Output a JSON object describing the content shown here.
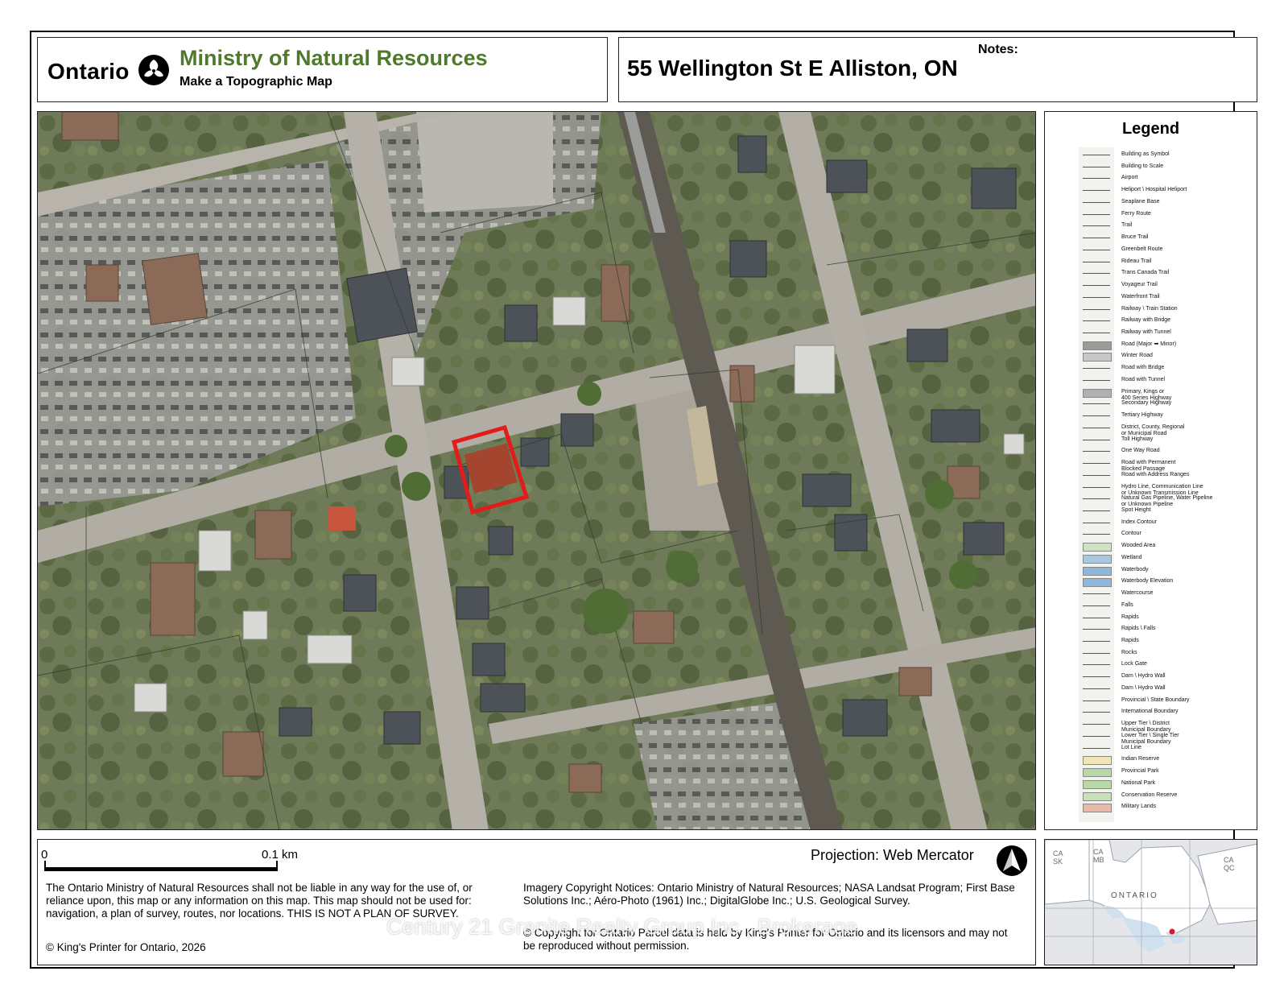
{
  "header": {
    "ontario_wordmark": "Ontario",
    "ministry": "Ministry of Natural Resources",
    "subtitle": "Make a Topographic Map",
    "address": "55 Wellington St E Alliston, ON",
    "notes_label": "Notes:"
  },
  "legend": {
    "title": "Legend",
    "items": [
      {
        "label": "Building as Symbol",
        "symbol": "dot-icon"
      },
      {
        "label": "Building to Scale",
        "symbol": "building-icon"
      },
      {
        "label": "Airport",
        "symbol": "airport-icon"
      },
      {
        "label": "Heliport \\ Hospital Heliport",
        "symbol": "heliport-icon"
      },
      {
        "label": "Seaplane Base",
        "symbol": "seaplane-icon"
      },
      {
        "label": "Ferry Route",
        "symbol": "ferry-icon"
      },
      {
        "label": "Trail",
        "symbol": "trail-icon"
      },
      {
        "label": "Bruce Trail",
        "symbol": "bruce-trail-icon"
      },
      {
        "label": "Greenbelt Route",
        "symbol": "greenbelt-icon"
      },
      {
        "label": "Rideau Trail",
        "symbol": "rideau-icon"
      },
      {
        "label": "Trans Canada Trail",
        "symbol": "trans-canada-icon"
      },
      {
        "label": "Voyageur Trail",
        "symbol": "voyageur-icon"
      },
      {
        "label": "Waterfront Trail",
        "symbol": "waterfront-icon"
      },
      {
        "label": "Railway \\ Train Station",
        "symbol": "railway-icon"
      },
      {
        "label": "Railway with Bridge",
        "symbol": "railway-bridge-icon"
      },
      {
        "label": "Railway with Tunnel",
        "symbol": "railway-tunnel-icon"
      },
      {
        "label": "Road (Major ➡ Minor)",
        "symbol": "road-icon"
      },
      {
        "label": "Winter Road",
        "symbol": "winter-road-icon"
      },
      {
        "label": "Road with Bridge",
        "symbol": "road-bridge-icon"
      },
      {
        "label": "Road with Tunnel",
        "symbol": "road-tunnel-icon"
      },
      {
        "label": "Primary, Kings or\n400 Series Highway",
        "symbol": "highway-icon"
      },
      {
        "label": "Secondary Highway",
        "symbol": "secondary-highway-icon"
      },
      {
        "label": "Tertiary Highway",
        "symbol": "tertiary-highway-icon"
      },
      {
        "label": "District, County, Regional\nor Municipal Road",
        "symbol": "county-road-icon"
      },
      {
        "label": "Toll Highway",
        "symbol": "toll-highway-icon"
      },
      {
        "label": "One Way Road",
        "symbol": "one-way-icon"
      },
      {
        "label": "Road with Permanent\nBlocked Passage",
        "symbol": "blocked-road-icon"
      },
      {
        "label": "Road with Address Ranges",
        "symbol": "address-range-icon"
      },
      {
        "label": "Hydro Line, Communication Line\nor Unknown Transmission Line",
        "symbol": "hydro-line-icon"
      },
      {
        "label": "Natural Gas Pipeline, Water Pipeline\nor Unknown Pipeline",
        "symbol": "pipeline-icon"
      },
      {
        "label": "Spot Height",
        "symbol": "spot-height-icon"
      },
      {
        "label": "Index Contour",
        "symbol": "index-contour-icon"
      },
      {
        "label": "Contour",
        "symbol": "contour-icon"
      },
      {
        "label": "Wooded Area",
        "symbol": "wooded-area-icon"
      },
      {
        "label": "Wetland",
        "symbol": "wetland-icon"
      },
      {
        "label": "Waterbody",
        "symbol": "waterbody-icon"
      },
      {
        "label": "Waterbody Elevation",
        "symbol": "waterbody-elevation-icon"
      },
      {
        "label": "Watercourse",
        "symbol": "watercourse-icon"
      },
      {
        "label": "Falls",
        "symbol": "falls-icon"
      },
      {
        "label": "Rapids",
        "symbol": "rapids-icon"
      },
      {
        "label": "Rapids \\ Falls",
        "symbol": "rapids-falls-icon"
      },
      {
        "label": "Rapids",
        "symbol": "rapids-icon"
      },
      {
        "label": "Rocks",
        "symbol": "rocks-icon"
      },
      {
        "label": "Lock Gate",
        "symbol": "lock-gate-icon"
      },
      {
        "label": "Dam \\ Hydro Wall",
        "symbol": "dam-icon"
      },
      {
        "label": "Dam \\ Hydro Wall",
        "symbol": "dam-icon"
      },
      {
        "label": "Provincial \\ State Boundary",
        "symbol": "provincial-boundary-icon"
      },
      {
        "label": "International Boundary",
        "symbol": "international-boundary-icon"
      },
      {
        "label": "Upper Tier \\ District\nMunicipal Boundary",
        "symbol": "upper-tier-boundary-icon"
      },
      {
        "label": "Lower Tier \\ Single Tier\nMunicipal Boundary",
        "symbol": "lower-tier-boundary-icon"
      },
      {
        "label": "Lot Line",
        "symbol": "lot-line-icon"
      },
      {
        "label": "Indian Reserve",
        "symbol": "reserve-icon"
      },
      {
        "label": "Provincial Park",
        "symbol": "provincial-park-icon"
      },
      {
        "label": "National Park",
        "symbol": "national-park-icon"
      },
      {
        "label": "Conservation Reserve",
        "symbol": "conservation-icon"
      },
      {
        "label": "Military Lands",
        "symbol": "military-icon"
      }
    ]
  },
  "scale": {
    "start_label": "0",
    "end_label": "0.1 km"
  },
  "projection": "Projection: Web Mercator",
  "disclaimer": "The Ontario Ministry of Natural Resources shall not be liable in any way for the use of, or reliance upon, this map or any information on this map.  This map should not be used for: navigation, a plan of survey, routes, nor locations. THIS IS NOT A PLAN OF SURVEY.",
  "imagery_notice": "Imagery Copyright Notices: Ontario Ministry of Natural Resources; NASA Landsat Program; First Base Solutions Inc.; Aéro-Photo (1961) Inc.; DigitalGlobe Inc.; U.S. Geological Survey.",
  "parcel_notice": "© Copyright for Ontario Parcel data is held by King's Printer for Ontario and its licensors and may not be reproduced without permission.",
  "kings_printer": "© King's Printer for Ontario, 2026",
  "watermark": "Century 21 Granite Realty Group Inc., Brokerage",
  "inset_map": {
    "labels": {
      "ca_sk": "CA\nSK",
      "ca_mb": "CA\nMB",
      "ca_qc": "CA\nQC",
      "ontario": "ONTARIO"
    },
    "colors": {
      "land": "#ffffff",
      "water": "#cfe0ee",
      "us_land": "#e4e6ea",
      "marker": "#d71920"
    }
  },
  "colors": {
    "ministry_green": "#4f7a2c",
    "subject_outline": "#e21b1b"
  }
}
